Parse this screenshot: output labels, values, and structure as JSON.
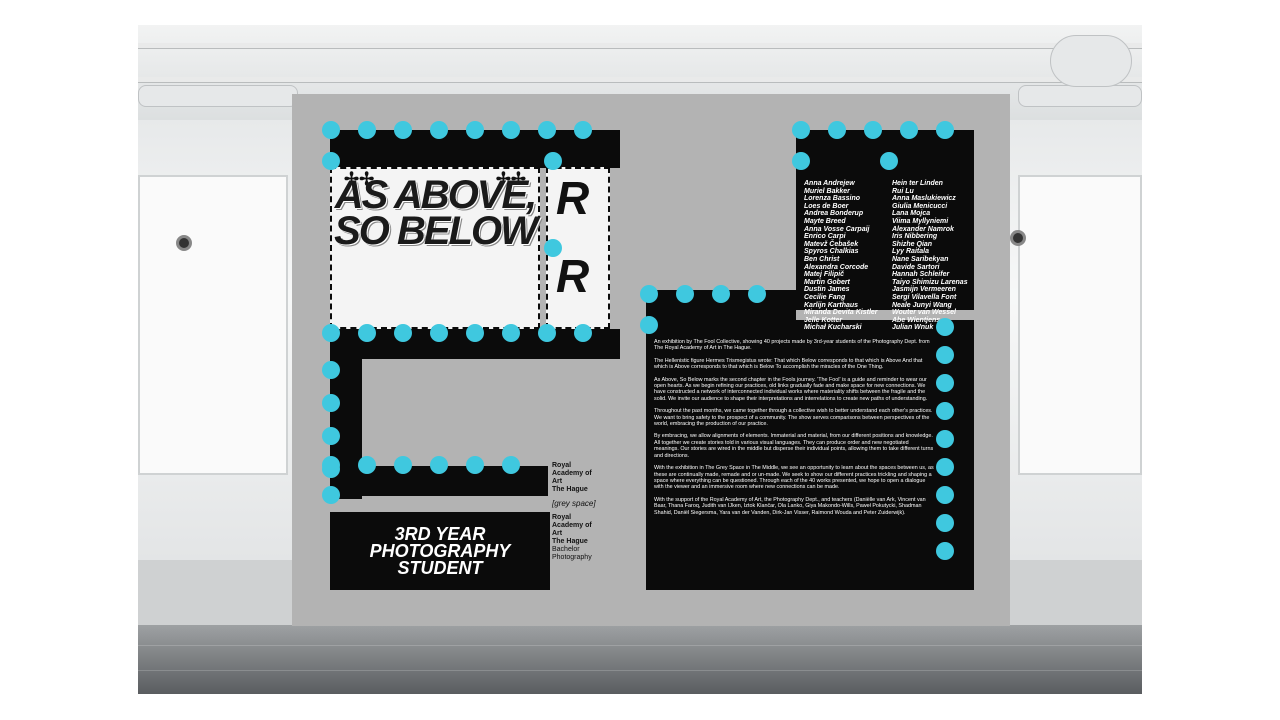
{
  "exhibition": {
    "title": "AS ABOVE, SO BELOW",
    "subtitle_line1": "3RD YEAR",
    "subtitle_line2": "PHOTOGRAPHY",
    "subtitle_line3": "STUDENT",
    "figure_glyph": "R",
    "plus_glyph": "✢✢"
  },
  "logo": {
    "line1": "Royal",
    "line2": "Academy of Art",
    "line3": "The Hague",
    "grey_space": "[grey space]",
    "line4": "Royal",
    "line5": "Academy of Art",
    "line6": "The Hague",
    "line7": "Bachelor",
    "line8": "Photography"
  },
  "names_left": [
    "Anna Andrejew",
    "Muriel Bakker",
    "Lorenza Bassino",
    "Loes de Boer",
    "Andrea Bonderup",
    "Mayte Breed",
    "Anna Vosse Carpaij",
    "Enrico Carpi",
    "Matevž Čebašek",
    "Spyros Chalkias",
    "Ben Christ",
    "Alexandra Corcode",
    "Matej Filipič",
    "Martin Gobert",
    "Dustin James",
    "Cecilie Fang",
    "Karlijn Karthaus",
    "Miranda Devita Kistler",
    "Jelle Kotter",
    "Michał Kucharski"
  ],
  "names_right": [
    "Hein ter Linden",
    "Rui Lu",
    "Anna Maslukiewicz",
    "Giulia Menicucci",
    "Lana Mojca",
    "Viima Myllyniemi",
    "Alexander Namrok",
    "Iris Nibbering",
    "Shizhe Qian",
    "Lyy Raitala",
    "Nane Saribekyan",
    "Davide Sartori",
    "Hannah Schleifer",
    "Taiyo Shimizu Larenas",
    "Jasmijn Vermeeren",
    "Sergi Vilavella Font",
    "Neale Junyi Wang",
    "Wouter van Wessel",
    "Abe Wientjens",
    "Julian Wnuk"
  ],
  "blurb": [
    "An exhibition by The Fool Collective, showing 40 projects made by 3rd-year students of the Photography Dept. from The Royal Academy of Art in The Hague.",
    "The Hellenistic figure Hermes Trismegistus wrote: That which Below corresponds to that which is Above And that which is Above corresponds to that which is Below To accomplish the miracles of the One Thing.",
    "As Above, So Below marks the second chapter in the Fools journey. 'The Fool' is a guide and reminder to wear our open hearts. As we begin refining our practices, old links gradually fade and make space for new connections. We have constructed a network of interconnected individual works where materiality shifts between the fragile and the solid. We invite our audience to shape their interpretations and interrelations to create new paths of understanding.",
    "Throughout the past months, we came together through a collective wish to better understand each other's practices. We want to bring safety to the prospect of a community. The show serves comparisons between perspectives of the world, embracing the production of our practice.",
    "By embracing, we allow alignments of elements. Immaterial and material, from our different positions and knowledge. All together we create stories told in various visual languages. They can produce order and new negotiated meanings. Our stories are wired in the middle but disperse their individual points, allowing them to take different turns and directions.",
    "With the exhibition in The Grey Space in The Middle, we see an opportunity to learn about the spaces between us, as these are continually made, remade and or un-made. We seek to show our different practices trickling and shaping a space where everything can be questioned. Through each of the 40 works presented, we hope to open a dialogue with the viewer and an immersive room where new connections can be made.",
    "With the support of the Royal Academy of Art, the Photography Dept., and teachers (Daniëlle van Ark, Vincent van Baar, Thana Faroq, Judith van IJken, Iztok Klančar, Ola Lanko, Giya Makondo-Wills, Paweł Pokutycki, Shadman Shahid, Daniël Siegersma, Yara van der Vanden, Dirk-Jan Visser, Raimond Wouda and Peter Zuiderwijk)."
  ],
  "colors": {
    "accent_dot": "#3fc8df",
    "panel": "#b3b3b3",
    "ink": "#0b0b0b"
  }
}
